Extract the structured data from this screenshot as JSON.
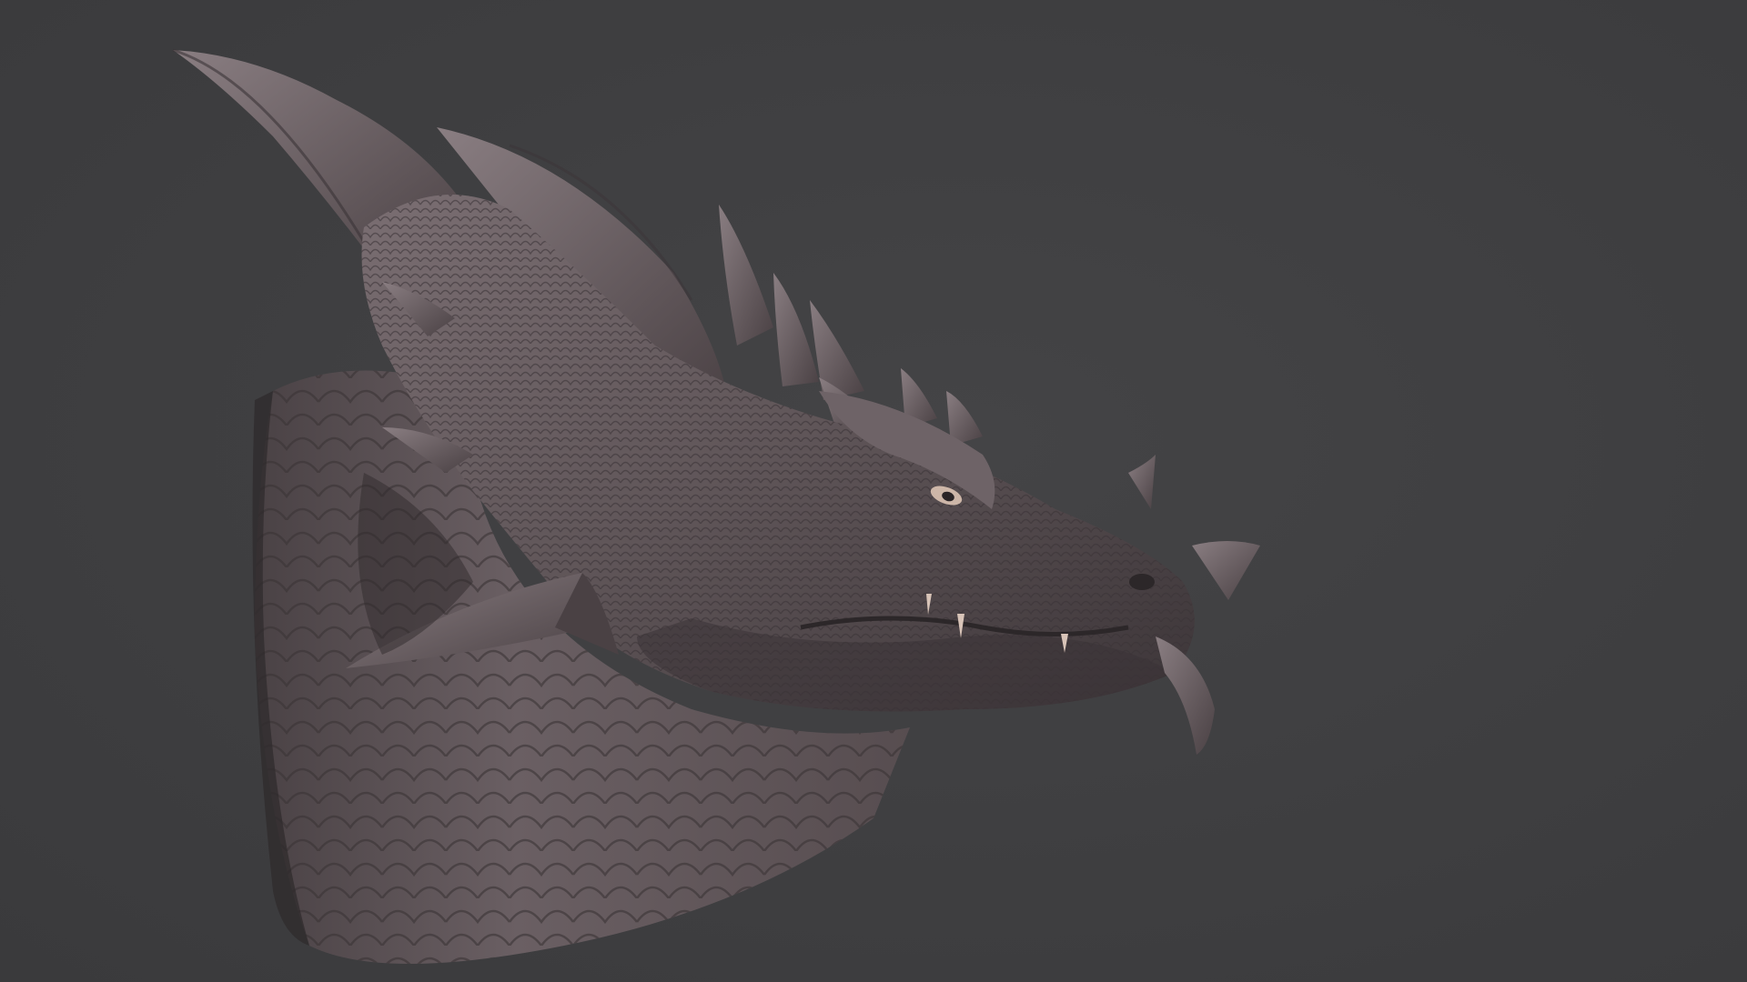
{
  "scene": {
    "subject": "dragon-head-sculpt",
    "background_color": "#3f3f41",
    "material_base_color": "#5f5558",
    "material_shadow_color": "#2e2a2c",
    "material_highlight_color": "#8c8084",
    "tooth_color": "#d8c4b8"
  }
}
